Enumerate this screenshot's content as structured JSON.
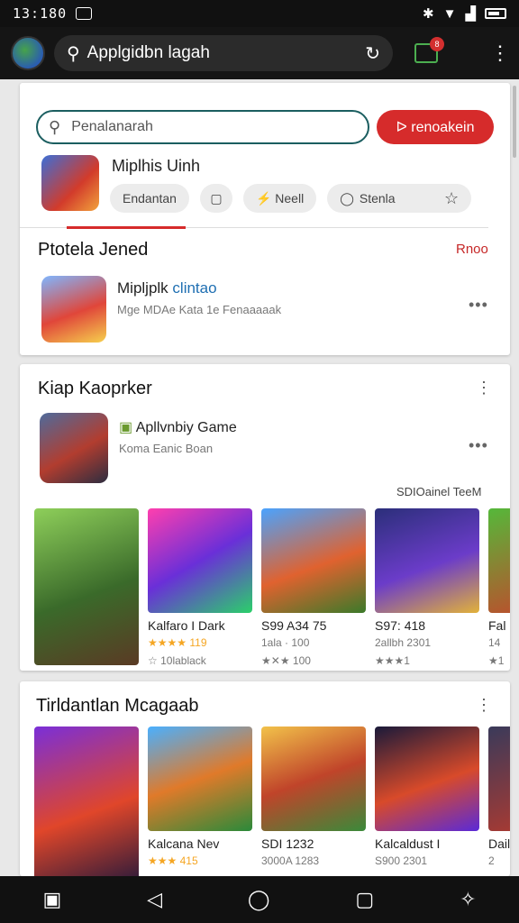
{
  "status": {
    "time": "13:180"
  },
  "browser": {
    "omnibox_text": "Applgidbn lagah",
    "tab_count": "8"
  },
  "search_card": {
    "search_placeholder": "Penalanarah",
    "search_button": "ᐅ renoakein",
    "app_title": "Miplhis Uinh",
    "chips": [
      "Endantan",
      "",
      "⚡ Neell",
      "Stenla"
    ]
  },
  "featured": {
    "title": "Ptotela Jened",
    "more": "Rnoo",
    "app_title_a": "Mipljplk",
    "app_title_b": "clintao",
    "app_sub": "Mge MDAe Kata 1e Fenaaaaak"
  },
  "section1": {
    "title": "Kiap Kaoprker",
    "app_title": "Apllvnbiy Game",
    "app_sub": "Koma Eanic Boan",
    "tag": "SDIOainel TeeM",
    "tiles": [
      {
        "name": "Kalfaro I Dark",
        "meta": "★★★★ 119",
        "meta2": "☆ 10lablack"
      },
      {
        "name": "S99 A34 75",
        "meta": "1ala · 100",
        "meta2": "★✕★ 100"
      },
      {
        "name": "S97: 418",
        "meta": "2allbh 2301",
        "meta2": "★★★1"
      },
      {
        "name": "Fal",
        "meta": "14",
        "meta2": "★1"
      }
    ]
  },
  "section2": {
    "title": "Tirldantlan Mcagaab",
    "tiles": [
      {
        "name": "Kalcana Nev",
        "meta": "★★★ 415"
      },
      {
        "name": "SDI 1232",
        "meta": "3000A 1283"
      },
      {
        "name": "Kalcaldust I",
        "meta": "S900 2301"
      },
      {
        "name": "Dail",
        "meta": "2"
      }
    ]
  }
}
